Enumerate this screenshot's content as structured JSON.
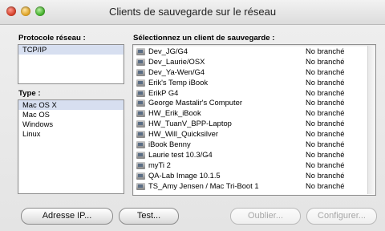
{
  "window": {
    "title": "Clients de sauvegarde sur le réseau"
  },
  "protocol": {
    "label": "Protocole réseau :",
    "items": [
      "TCP/IP"
    ]
  },
  "type": {
    "label": "Type :",
    "items": [
      "Mac OS X",
      "Mac OS",
      "Windows",
      "Linux"
    ]
  },
  "clients": {
    "label": "Sélectionnez un client de sauvegarde :",
    "rows": [
      {
        "name": "Dev_JG/G4",
        "status": "No branché"
      },
      {
        "name": "Dev_Laurie/OSX",
        "status": "No branché"
      },
      {
        "name": "Dev_Ya-Wen/G4",
        "status": "No branché"
      },
      {
        "name": "Erik's Temp iBook",
        "status": "No branché"
      },
      {
        "name": "ErikP G4",
        "status": "No branché"
      },
      {
        "name": "George Mastalir's Computer",
        "status": "No branché"
      },
      {
        "name": "HW_Erik_iBook",
        "status": "No branché"
      },
      {
        "name": "HW_TuanV_BPP-Laptop",
        "status": "No branché"
      },
      {
        "name": "HW_Will_Quicksilver",
        "status": "No branché"
      },
      {
        "name": "iBook Benny",
        "status": "No branché"
      },
      {
        "name": "Laurie test 10.3/G4",
        "status": "No branché"
      },
      {
        "name": "myTi 2",
        "status": "No branché"
      },
      {
        "name": "QA-Lab Image 10.1.5",
        "status": "No branché"
      },
      {
        "name": "TS_Amy Jensen / Mac Tri-Boot 1",
        "status": "No branché"
      }
    ]
  },
  "buttons": {
    "ip": "Adresse IP...",
    "test": "Test...",
    "remove": "Oublier...",
    "configure": "Configurer..."
  }
}
